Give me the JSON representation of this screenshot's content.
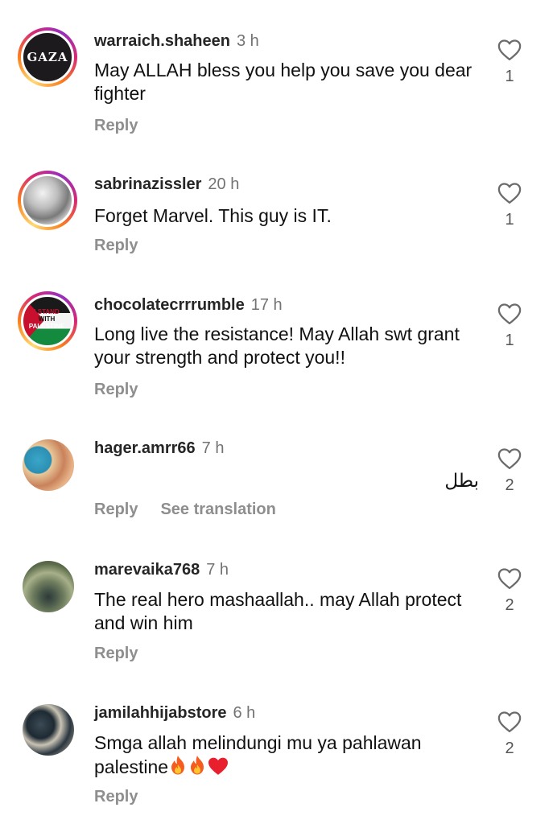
{
  "comments": [
    {
      "username": "warraich.shaheen",
      "time": "3 h",
      "text": "May ALLAH bless you help you save you dear fighter",
      "reply": "Reply",
      "likes": "1",
      "avatar_text": "GAZA"
    },
    {
      "username": "sabrinazissler",
      "time": "20 h",
      "text": "Forget Marvel. This guy is IT.",
      "reply": "Reply",
      "likes": "1"
    },
    {
      "username": "chocolatecrrrumble",
      "time": "17 h",
      "text": "Long live the resistance! May Allah swt grant your strength and protect you!!",
      "reply": "Reply",
      "likes": "1",
      "avatar_text_1": "I STAND",
      "avatar_text_2": "WITH",
      "avatar_text_3": "PALESTINE"
    },
    {
      "username": "hager.amrr66",
      "time": "7 h",
      "text": "بطل",
      "reply": "Reply",
      "see_translation": "See translation",
      "likes": "2"
    },
    {
      "username": "marevaika768",
      "time": "7 h",
      "text": "The real hero mashaallah.. may Allah protect and win him",
      "reply": "Reply",
      "likes": "2"
    },
    {
      "username": "jamilahhijabstore",
      "time": "6 h",
      "text": "Smga allah melindungi mu ya pahlawan palestine",
      "reply": "Reply",
      "likes": "2",
      "emoji_icons": [
        "fire-emoji",
        "fire-emoji",
        "red-heart-emoji"
      ]
    }
  ],
  "colors": {
    "username": "#262626",
    "meta": "#8e8e8e",
    "story_ring": [
      "#feda75",
      "#fa7e1e",
      "#d62976",
      "#962fbf"
    ]
  }
}
